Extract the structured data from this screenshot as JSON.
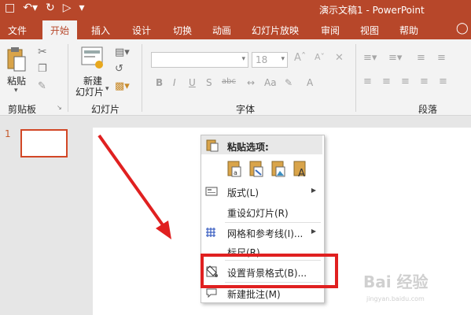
{
  "title_bar": {
    "doc_title": "演示文稿1 - PowerPoint"
  },
  "tabs": [
    "文件",
    "开始",
    "插入",
    "设计",
    "切换",
    "动画",
    "幻灯片放映",
    "审阅",
    "视图",
    "帮助"
  ],
  "ribbon": {
    "clipboard": {
      "paste_label": "粘贴",
      "group_label": "剪贴板"
    },
    "slides": {
      "new_slide_line1": "新建",
      "new_slide_line2": "幻灯片",
      "group_label": "幻灯片"
    },
    "font": {
      "font_name": "",
      "font_size": "18",
      "group_label": "字体"
    },
    "paragraph": {
      "group_label": "段落"
    }
  },
  "thumbnails": {
    "slide_number": "1"
  },
  "context_menu": {
    "paste_header": "粘贴选项:",
    "items": [
      {
        "label": "版式(L)",
        "has_submenu": true,
        "icon": "layout-icon"
      },
      {
        "label": "重设幻灯片(R)",
        "has_submenu": false,
        "icon": ""
      },
      {
        "label": "网格和参考线(I)...",
        "has_submenu": true,
        "icon": "grid-icon"
      },
      {
        "label": "标尺(R)",
        "has_submenu": false,
        "icon": ""
      },
      {
        "label": "设置背景格式(B)...",
        "has_submenu": false,
        "icon": "format-background-icon"
      },
      {
        "label": "新建批注(M)",
        "has_submenu": false,
        "icon": "comment-icon"
      }
    ]
  },
  "watermark": {
    "text": "Bai 经验",
    "sub": "jingyan.baidu.com"
  },
  "colors": {
    "accent": "#b7472a",
    "highlight": "#e02020"
  }
}
